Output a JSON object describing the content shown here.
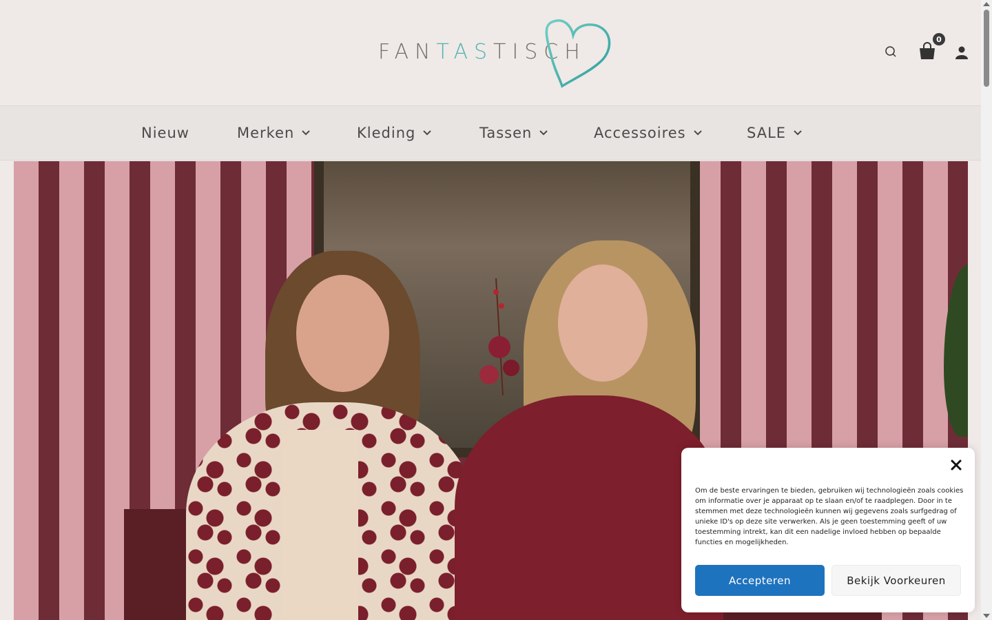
{
  "header": {
    "logo": {
      "part1": "FAN",
      "part2": "TAS",
      "part3": "TISCH",
      "accent_color": "#4fb3b0",
      "text_color": "#707068"
    },
    "cart_count": "0",
    "icons": [
      "search-icon",
      "cart-icon",
      "account-icon"
    ]
  },
  "nav": {
    "items": [
      {
        "label": "Nieuw",
        "has_dropdown": false
      },
      {
        "label": "Merken",
        "has_dropdown": true
      },
      {
        "label": "Kleding",
        "has_dropdown": true
      },
      {
        "label": "Tassen",
        "has_dropdown": true
      },
      {
        "label": "Accessoires",
        "has_dropdown": true
      },
      {
        "label": "SALE",
        "has_dropdown": true
      }
    ]
  },
  "cookie_banner": {
    "text": "Om de beste ervaringen te bieden, gebruiken wij technologieën zoals cookies om informatie over je apparaat op te slaan en/of te raadplegen. Door in te stemmen met deze technologieën kunnen wij gegevens zoals surfgedrag of unieke ID's op deze site verwerken. Als je geen toestemming geeft of uw toestemming intrekt, kan dit een nadelige invloed hebben op bepaalde functies en mogelijkheden.",
    "accept_label": "Accepteren",
    "preferences_label": "Bekijk Voorkeuren",
    "accept_color": "#1e73be"
  },
  "colors": {
    "page_bg": "#efe9e7",
    "nav_bg": "#e8e4e1",
    "nav_text": "#4a4a4a"
  }
}
